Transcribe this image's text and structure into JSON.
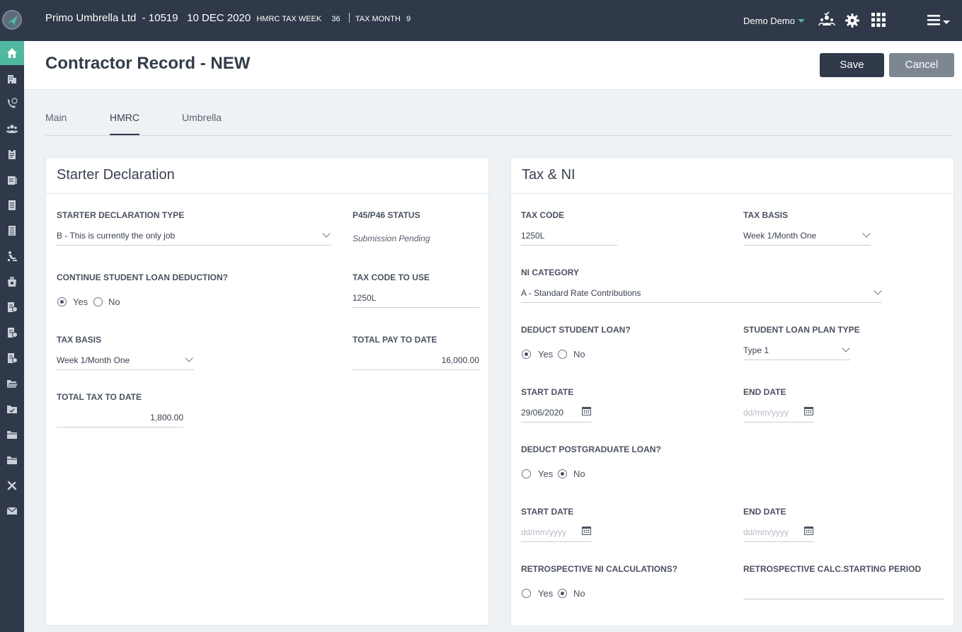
{
  "topbar": {
    "company": "Primo Umbrella Ltd",
    "company_id": "- 10519",
    "date": "10 DEC 2020",
    "tax_week_label": "HMRC TAX WEEK",
    "tax_week_value": "36",
    "tax_month_label": "TAX MONTH",
    "tax_month_value": "9",
    "user_name": "Demo Demo",
    "icons": [
      "users-check-icon",
      "gear-icon",
      "apps-grid-icon",
      "hamburger-menu-icon"
    ]
  },
  "sidebar": {
    "items": [
      "home-icon",
      "building-icon",
      "phone-24-icon",
      "users-icon",
      "clipboard-icon",
      "invoice-icon",
      "document-icon",
      "list-document-icon",
      "person-desk-icon",
      "money-box-icon",
      "report-icon",
      "report-2-icon",
      "report-3-icon",
      "folder-open-icon",
      "folder-check-icon",
      "folder-icon",
      "folder-2-icon",
      "tools-icon",
      "envelope-icon"
    ],
    "active_index": 0
  },
  "header": {
    "title": "Contractor Record - NEW",
    "save_label": "Save",
    "cancel_label": "Cancel"
  },
  "tabs": [
    {
      "label": "Main",
      "active": false
    },
    {
      "label": "HMRC",
      "active": true
    },
    {
      "label": "Umbrella",
      "active": false
    }
  ],
  "starter": {
    "title": "Starter Declaration",
    "decl_type_label": "STARTER DECLARATION TYPE",
    "decl_type_value": "B - This is currently the only job",
    "p45_label": "P45/P46 STATUS",
    "p45_value": "Submission Pending",
    "student_loan_label": "CONTINUE STUDENT LOAN DEDUCTION?",
    "yes": "Yes",
    "no": "No",
    "student_loan_selected": "Yes",
    "tax_code_label": "TAX CODE TO USE",
    "tax_code_value": "1250L",
    "tax_basis_label": "TAX BASIS",
    "tax_basis_value": "Week 1/Month One",
    "total_pay_label": "TOTAL PAY TO DATE",
    "total_pay_value": "16,000.00",
    "total_tax_label": "TOTAL TAX TO DATE",
    "total_tax_value": "1,800.00"
  },
  "taxni": {
    "title": "Tax & NI",
    "tax_code_label": "TAX CODE",
    "tax_code_value": "1250L",
    "tax_basis_label": "TAX BASIS",
    "tax_basis_value": "Week 1/Month One",
    "ni_label": "NI CATEGORY",
    "ni_value": "A - Standard Rate Contributions",
    "deduct_sl_label": "DEDUCT STUDENT LOAN?",
    "deduct_sl_selected": "Yes",
    "plan_type_label": "STUDENT LOAN PLAN TYPE",
    "plan_type_value": "Type 1",
    "start_date_label": "START DATE",
    "start_date_value": "29/06/2020",
    "end_date_label": "END DATE",
    "date_placeholder": "dd/mm/yyyy",
    "deduct_pg_label": "DEDUCT POSTGRADUATE LOAN?",
    "deduct_pg_selected": "No",
    "pg_start_label": "START DATE",
    "pg_end_label": "END DATE",
    "retro_label": "RETROSPECTIVE NI CALCULATIONS?",
    "retro_selected": "No",
    "retro_period_label": "RETROSPECTIVE CALC.STARTING PERIOD",
    "retro_period_value": "",
    "yes": "Yes",
    "no": "No"
  }
}
